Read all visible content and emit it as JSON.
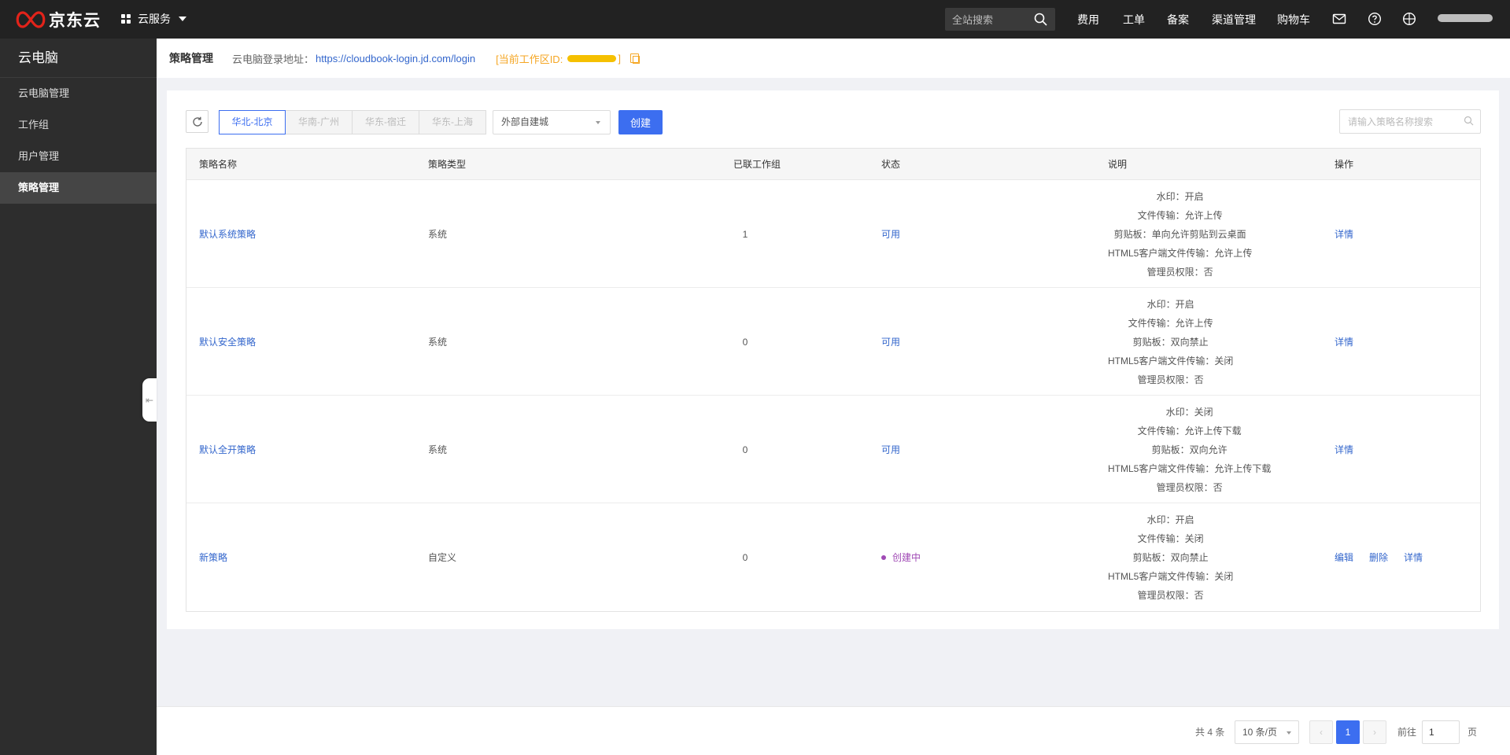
{
  "topbar": {
    "logo_text": "京东云",
    "cloud_services": "云服务",
    "search_placeholder": "全站搜索",
    "nav": [
      "费用",
      "工单",
      "备案",
      "渠道管理",
      "购物车"
    ]
  },
  "sidebar": {
    "title": "云电脑",
    "items": [
      {
        "label": "云电脑管理",
        "active": false
      },
      {
        "label": "工作组",
        "active": false
      },
      {
        "label": "用户管理",
        "active": false
      },
      {
        "label": "策略管理",
        "active": true
      }
    ],
    "collapse_glyph": "⇤"
  },
  "header": {
    "page_title": "策略管理",
    "login_label": "云电脑登录地址：",
    "login_url": "https://cloudbook-login.jd.com/login",
    "workspace_prefix": "[当前工作区ID:",
    "workspace_suffix": "]"
  },
  "toolbar": {
    "regions": [
      {
        "label": "华北-北京",
        "active": true
      },
      {
        "label": "华南-广州",
        "active": false
      },
      {
        "label": "华东-宿迁",
        "active": false
      },
      {
        "label": "华东-上海",
        "active": false
      }
    ],
    "region_select": "外部自建城",
    "create_label": "创建",
    "search_placeholder": "请输入策略名称搜索"
  },
  "table": {
    "headers": [
      "策略名称",
      "策略类型",
      "已联工作组",
      "状态",
      "说明",
      "操作"
    ],
    "rows": [
      {
        "name": "默认系统策略",
        "type": "系统",
        "count": "1",
        "status": "可用",
        "pending": false,
        "desc": [
          "水印：开启",
          "文件传输：允许上传",
          "剪贴板：单向允许剪贴到云桌面",
          "HTML5客户端文件传输：允许上传",
          "管理员权限：否"
        ],
        "ops": [
          "详情"
        ]
      },
      {
        "name": "默认安全策略",
        "type": "系统",
        "count": "0",
        "status": "可用",
        "pending": false,
        "desc": [
          "水印：开启",
          "文件传输：允许上传",
          "剪贴板：双向禁止",
          "HTML5客户端文件传输：关闭",
          "管理员权限：否"
        ],
        "ops": [
          "详情"
        ]
      },
      {
        "name": "默认全开策略",
        "type": "系统",
        "count": "0",
        "status": "可用",
        "pending": false,
        "desc": [
          "水印：关闭",
          "文件传输：允许上传下载",
          "剪贴板：双向允许",
          "HTML5客户端文件传输：允许上传下载",
          "管理员权限：否"
        ],
        "ops": [
          "详情"
        ]
      },
      {
        "name": "新策略",
        "type": "自定义",
        "count": "0",
        "status": "创建中",
        "pending": true,
        "desc": [
          "水印：开启",
          "文件传输：关闭",
          "剪贴板：双向禁止",
          "HTML5客户端文件传输：关闭",
          "管理员权限：否"
        ],
        "ops": [
          "编辑",
          "删除",
          "详情"
        ]
      }
    ]
  },
  "pagination": {
    "total": "共 4 条",
    "page_size": "10 条/页",
    "prev": "‹",
    "current": "1",
    "next": "›",
    "goto_label": "前往",
    "goto_value": "1",
    "page_suffix": "页"
  },
  "colors": {
    "accent": "#3c6ef0",
    "link": "#3366cc",
    "pending": "#a04ab5",
    "workspace": "#f5a623",
    "topbar_bg": "#222222",
    "sidebar_bg": "#2d2d2d"
  }
}
